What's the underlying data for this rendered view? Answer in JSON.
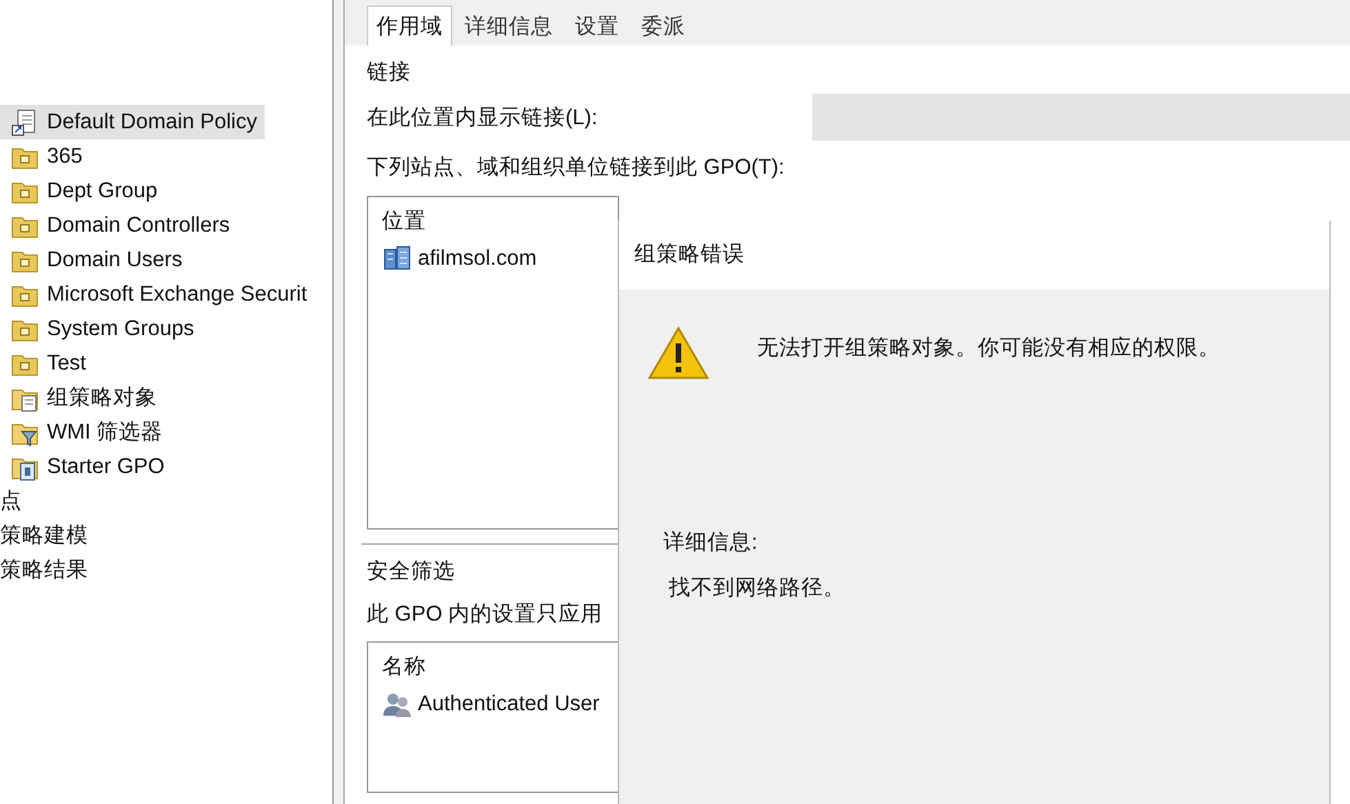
{
  "tree": [
    {
      "label": "Default Domain Policy",
      "kind": "gpo-link",
      "selected": true
    },
    {
      "label": "365",
      "kind": "ou",
      "selected": false
    },
    {
      "label": "Dept Group",
      "kind": "ou",
      "selected": false
    },
    {
      "label": "Domain Controllers",
      "kind": "ou",
      "selected": false
    },
    {
      "label": "Domain Users",
      "kind": "ou",
      "selected": false
    },
    {
      "label": "Microsoft Exchange Securit",
      "kind": "ou",
      "selected": false
    },
    {
      "label": "System Groups",
      "kind": "ou",
      "selected": false
    },
    {
      "label": "Test",
      "kind": "ou",
      "selected": false
    },
    {
      "label": "组策略对象",
      "kind": "gpo-folder",
      "selected": false
    },
    {
      "label": "WMI 筛选器",
      "kind": "wmi",
      "selected": false
    },
    {
      "label": "Starter GPO",
      "kind": "starter",
      "selected": false
    },
    {
      "label": "点",
      "kind": "root",
      "selected": false
    },
    {
      "label": "策略建模",
      "kind": "root",
      "selected": false
    },
    {
      "label": "策略结果",
      "kind": "root",
      "selected": false
    }
  ],
  "tabs": [
    {
      "label": "作用域",
      "selected": true
    },
    {
      "label": "详细信息",
      "selected": false
    },
    {
      "label": "设置",
      "selected": false
    },
    {
      "label": "委派",
      "selected": false
    }
  ],
  "links": {
    "heading": "链接",
    "location_label": "在此位置内显示链接(L):",
    "list_label": "下列站点、域和组织单位链接到此 GPO(T):",
    "column": "位置",
    "rows": [
      "afilmsol.com"
    ]
  },
  "security": {
    "heading": "安全筛选",
    "description": "此 GPO 内的设置只应用",
    "column": "名称",
    "rows": [
      "Authenticated User"
    ]
  },
  "dialog": {
    "title": "组策略错误",
    "message": "无法打开组策略对象。你可能没有相应的权限。",
    "details_label": "详细信息:",
    "details": "找不到网络路径。"
  }
}
